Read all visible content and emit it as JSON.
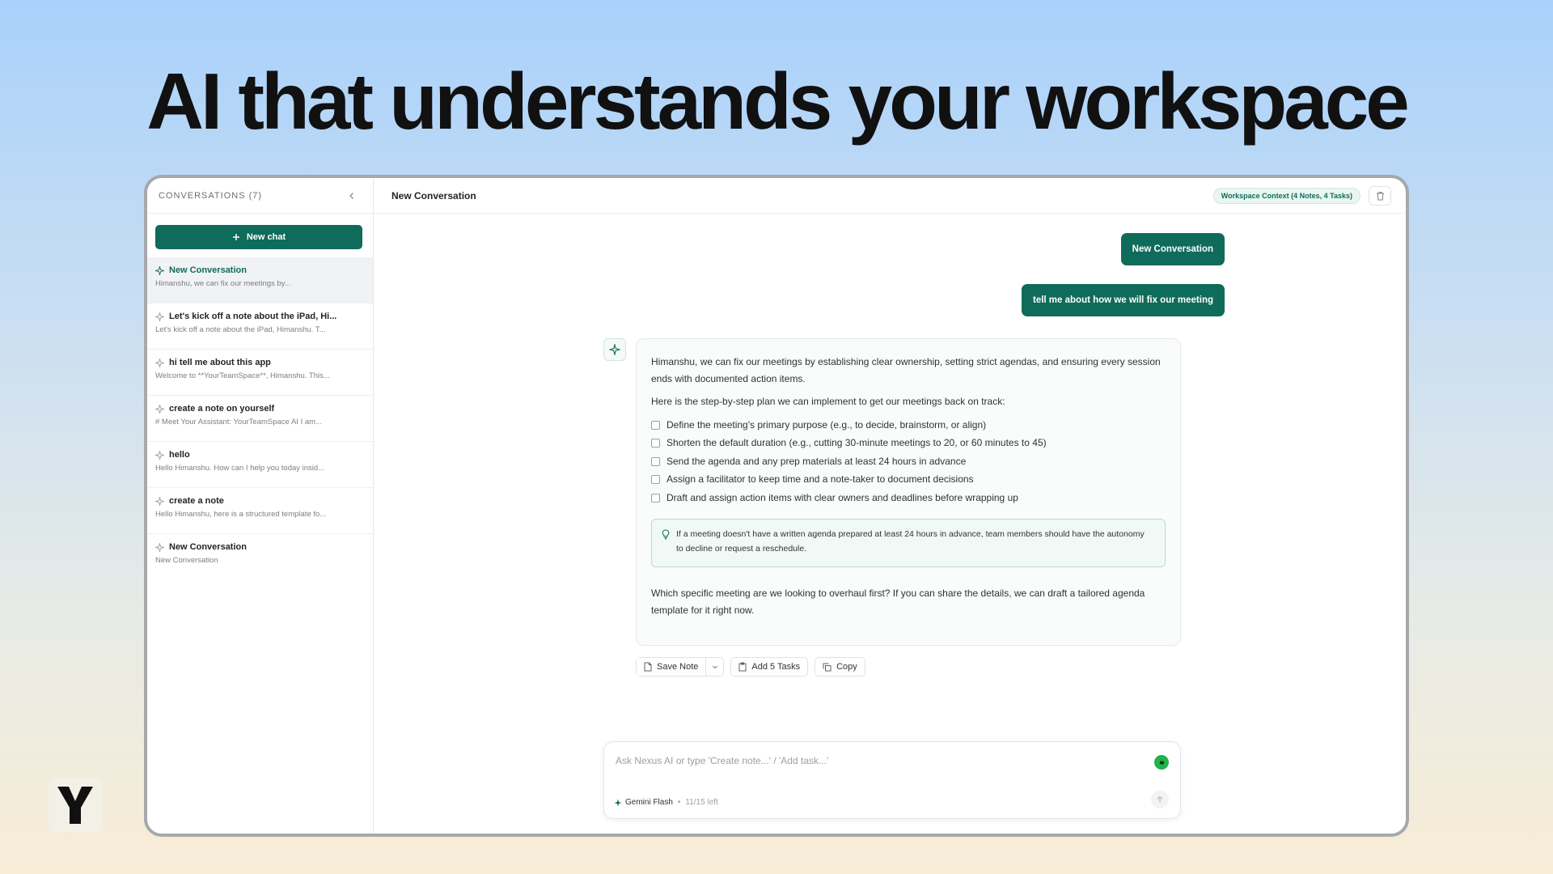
{
  "hero": {
    "title": "AI that understands your workspace"
  },
  "sidebar": {
    "header": "CONVERSATIONS (7)",
    "new_chat_label": "New chat",
    "conversations": [
      {
        "title": "New Conversation",
        "preview": "Himanshu, we can fix our meetings by...",
        "active": true
      },
      {
        "title": "Let's kick off a note about the iPad, Hi...",
        "preview": "Let's kick off a note about the iPad, Himanshu. T..."
      },
      {
        "title": "hi tell me about this app",
        "preview": "Welcome to **YourTeamSpace**, Himanshu. This..."
      },
      {
        "title": "create a note on yourself",
        "preview": "# Meet Your Assistant: YourTeamSpace AI I am..."
      },
      {
        "title": "hello",
        "preview": "Hello Himanshu. How can I help you today insid..."
      },
      {
        "title": "create a note",
        "preview": "Hello Himanshu, here is a structured template fo..."
      },
      {
        "title": "New Conversation",
        "preview": "New Conversation"
      }
    ]
  },
  "main": {
    "title": "New Conversation",
    "context_badge": "Workspace Context (4 Notes, 4 Tasks)",
    "messages": {
      "user_1": "New Conversation",
      "user_2": "tell me about how we will fix our meeting"
    },
    "ai_response": {
      "intro": "Himanshu, we can fix our meetings by establishing clear ownership, setting strict agendas, and ensuring every session ends with documented action items.",
      "lead": "Here is the step-by-step plan we can implement to get our meetings back on track:",
      "checklist": [
        "Define the meeting's primary purpose (e.g., to decide, brainstorm, or align)",
        "Shorten the default duration (e.g., cutting 30-minute meetings to 20, or 60 minutes to 45)",
        "Send the agenda and any prep materials at least 24 hours in advance",
        "Assign a facilitator to keep time and a note-taker to document decisions",
        "Draft and assign action items with clear owners and deadlines before wrapping up"
      ],
      "tip": "If a meeting doesn't have a written agenda prepared at least 24 hours in advance, team members should have the autonomy to decline or request a reschedule.",
      "closing": "Which specific meeting are we looking to overhaul first? If you can share the details, we can draft a tailored agenda template for it right now."
    },
    "actions": {
      "save_note": "Save Note",
      "add_tasks": "Add 5 Tasks",
      "copy": "Copy"
    },
    "composer": {
      "placeholder": "Ask Nexus AI or type 'Create note...' / 'Add task...'",
      "model": "Gemini Flash",
      "quota": "11/15 left"
    }
  },
  "colors": {
    "accent": "#0f6b5a",
    "mic": "#22b14c"
  }
}
